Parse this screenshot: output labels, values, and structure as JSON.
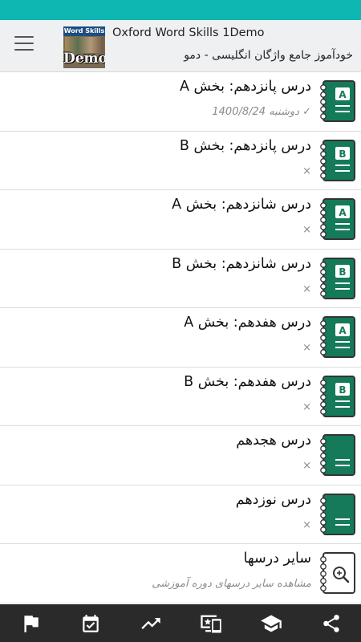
{
  "app": {
    "title": "Oxford Word Skills 1Demo",
    "subtitle": "خودآموز جامع واژگان انگلیسی - دمو",
    "logo_top_text": "Word Skills",
    "logo_bottom_text": "Demo",
    "accent_color": "#0fb7b3",
    "icon_color": "#157a5a"
  },
  "lessons": [
    {
      "title": "درس پانزدهم: بخش A",
      "subtitle": "✓ دوشنبه 1400/8/24",
      "badge": "A"
    },
    {
      "title": "درس پانزدهم: بخش B",
      "subtitle": "×",
      "badge": "B"
    },
    {
      "title": "درس شانزدهم: بخش A",
      "subtitle": "×",
      "badge": "A"
    },
    {
      "title": "درس شانزدهم: بخش B",
      "subtitle": "×",
      "badge": "B"
    },
    {
      "title": "درس هفدهم: بخش A",
      "subtitle": "×",
      "badge": "A"
    },
    {
      "title": "درس هفدهم: بخش B",
      "subtitle": "×",
      "badge": "B"
    },
    {
      "title": "درس هجدهم",
      "subtitle": "×",
      "badge": ""
    },
    {
      "title": "درس نوزدهم",
      "subtitle": "×",
      "badge": ""
    },
    {
      "title": "سایر درسها",
      "subtitle": "مشاهده سایر درسهای دوره آموزشی",
      "badge": "",
      "icon": "search-notebook-icon"
    }
  ],
  "bottom_nav": [
    {
      "icon": "flag-icon"
    },
    {
      "icon": "calendar-check-icon"
    },
    {
      "icon": "trending-up-icon"
    },
    {
      "icon": "devices-star-icon"
    },
    {
      "icon": "graduation-cap-icon"
    },
    {
      "icon": "share-icon"
    }
  ]
}
